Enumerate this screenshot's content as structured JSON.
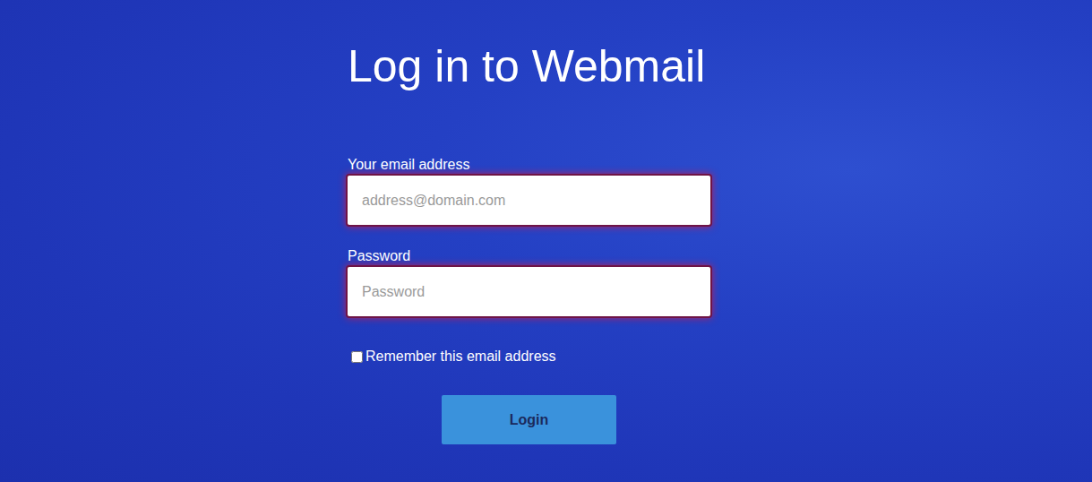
{
  "page": {
    "title": "Log in to Webmail"
  },
  "fields": [
    {
      "label": "Your email address",
      "placeholder": "address@domain.com",
      "kind": "email",
      "invalid": true
    },
    {
      "label": "Password",
      "placeholder": "Password",
      "kind": "password",
      "invalid": true
    }
  ],
  "remember": {
    "label": "Remember this email address",
    "checked": false
  },
  "buttons": [
    "Login"
  ]
}
